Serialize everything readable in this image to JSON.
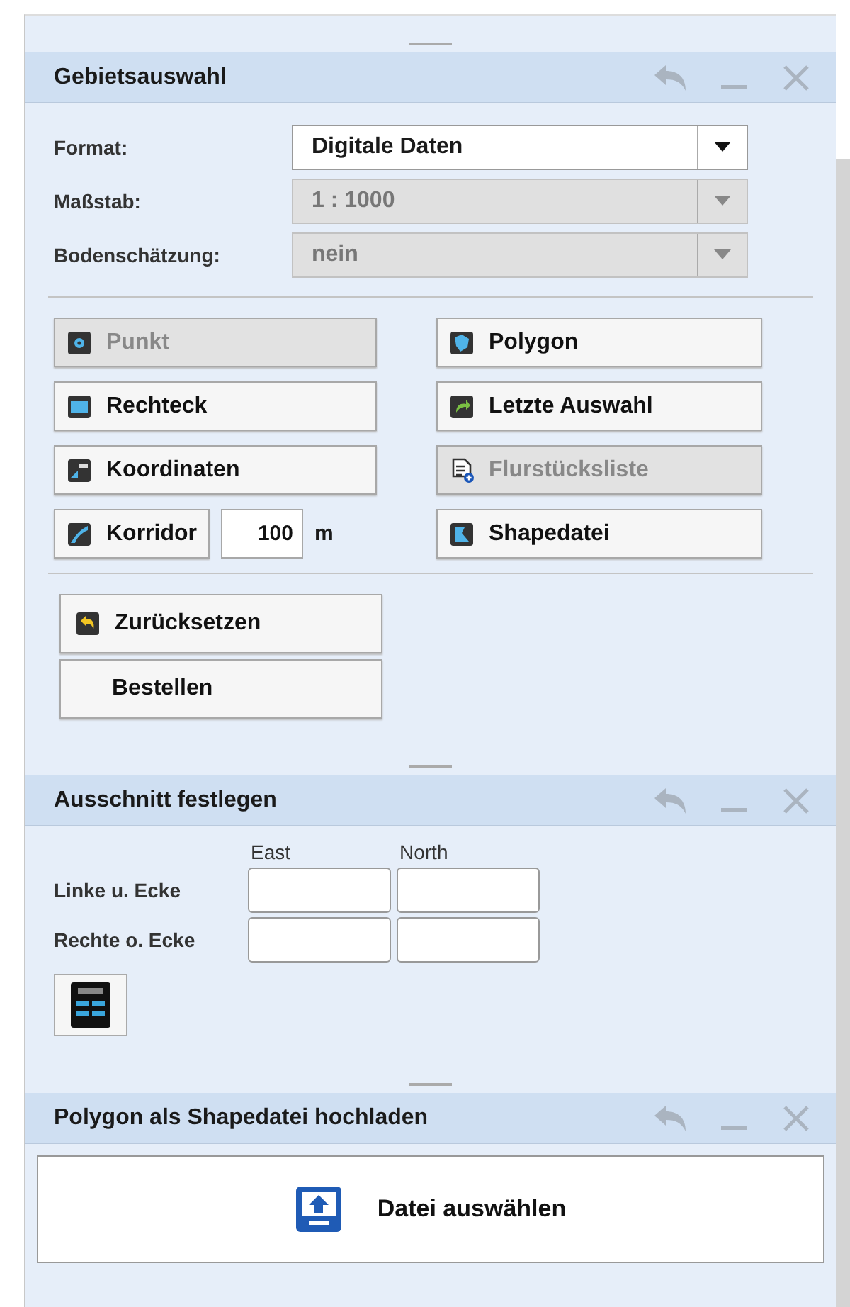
{
  "area_selection": {
    "title": "Gebietsauswahl",
    "fields": [
      {
        "label": "Format:",
        "value": "Digitale Daten",
        "disabled": false
      },
      {
        "label": "Maßstab:",
        "value": "1 : 1000",
        "disabled": true
      },
      {
        "label": "Bodenschätzung:",
        "value": "nein",
        "disabled": true
      }
    ],
    "tools": [
      {
        "kind": "button",
        "label": "Punkt",
        "disabled": true
      },
      {
        "kind": "button",
        "label": "Polygon",
        "disabled": false
      },
      {
        "kind": "button",
        "label": "Rechteck",
        "disabled": false
      },
      {
        "kind": "button",
        "label": "Letzte Auswahl",
        "disabled": false
      },
      {
        "kind": "button",
        "label": "Koordinaten",
        "disabled": false
      },
      {
        "kind": "button",
        "label": "Flurstücksliste",
        "disabled": true
      },
      {
        "kind": "corridor",
        "label": "Korridor",
        "disabled": false,
        "value": "100",
        "unit": "m"
      },
      {
        "kind": "button",
        "label": "Shapedatei",
        "disabled": false
      }
    ],
    "actions": [
      {
        "label": "Zurücksetzen",
        "kind": "reset"
      },
      {
        "label": "Bestellen",
        "kind": "plain"
      }
    ]
  },
  "extent": {
    "title": "Ausschnitt festlegen",
    "columns": [
      "East",
      "North"
    ],
    "rows": [
      {
        "label": "Linke u. Ecke"
      },
      {
        "label": "Rechte o. Ecke"
      }
    ]
  },
  "upload": {
    "title": "Polygon als Shapedatei hochladen",
    "button": "Datei auswählen"
  }
}
